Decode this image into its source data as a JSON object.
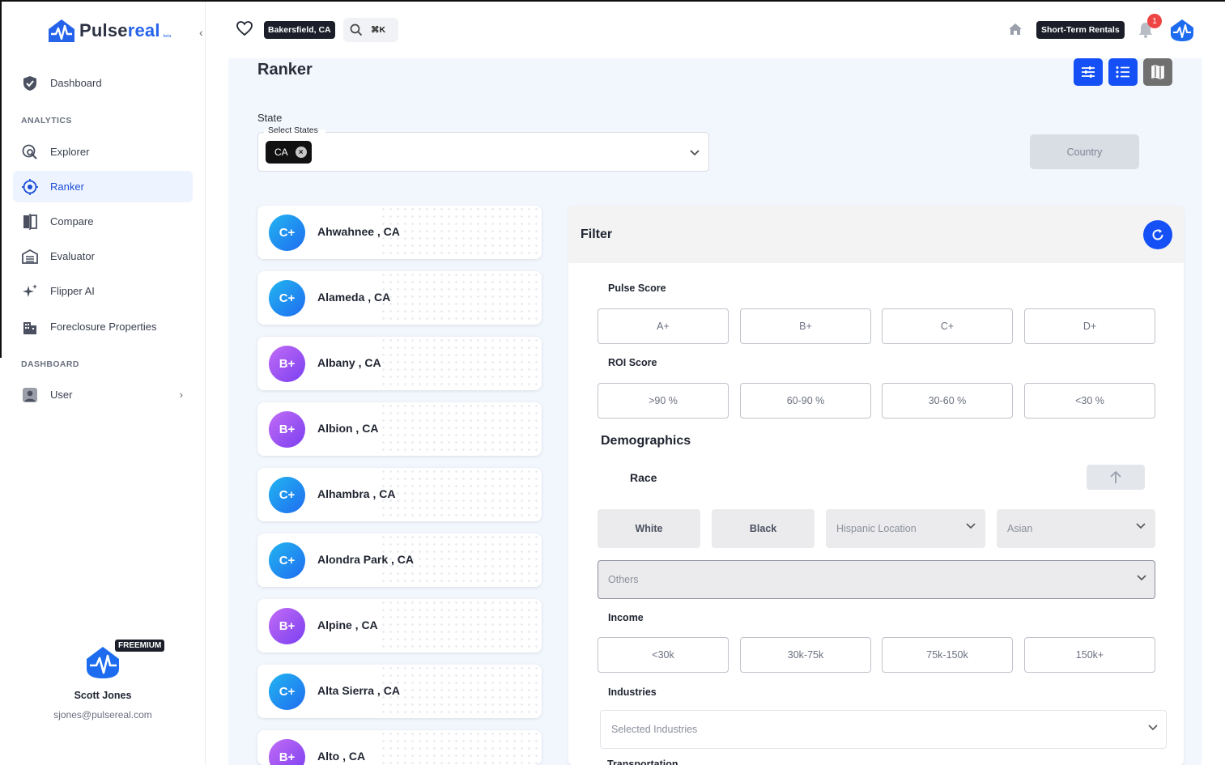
{
  "brand": {
    "name_part1": "Pulse",
    "name_part2": "real",
    "subtitle": "beta"
  },
  "sidebar": {
    "dashboard": "Dashboard",
    "analytics_section": "ANALYTICS",
    "items": [
      {
        "label": "Explorer"
      },
      {
        "label": "Ranker"
      },
      {
        "label": "Compare"
      },
      {
        "label": "Evaluator"
      },
      {
        "label": "Flipper AI"
      },
      {
        "label": "Foreclosure Properties"
      }
    ],
    "dashboard_section": "DASHBOARD",
    "user": "User"
  },
  "profile": {
    "badge": "FREEMIUM",
    "name": "Scott Jones",
    "email": "sjones@pulsereal.com"
  },
  "topbar": {
    "location": "Bakersfield, CA",
    "shortcut": "⌘K",
    "mode": "Short-Term Rentals",
    "notifications": "1"
  },
  "page": {
    "title": "Ranker",
    "state_label": "State",
    "select_label": "Select States",
    "selected_state": "CA",
    "country_button": "Country"
  },
  "cities": [
    {
      "grade": "C+",
      "name": "Ahwahnee , CA"
    },
    {
      "grade": "C+",
      "name": "Alameda , CA"
    },
    {
      "grade": "B+",
      "name": "Albany , CA"
    },
    {
      "grade": "B+",
      "name": "Albion , CA"
    },
    {
      "grade": "C+",
      "name": "Alhambra , CA"
    },
    {
      "grade": "C+",
      "name": "Alondra Park , CA"
    },
    {
      "grade": "B+",
      "name": "Alpine , CA"
    },
    {
      "grade": "C+",
      "name": "Alta Sierra , CA"
    },
    {
      "grade": "B+",
      "name": "Alto , CA"
    }
  ],
  "filter": {
    "title": "Filter",
    "pulse_score": {
      "label": "Pulse Score",
      "options": [
        "A+",
        "B+",
        "C+",
        "D+"
      ]
    },
    "roi_score": {
      "label": "ROI Score",
      "options": [
        ">90 %",
        "60-90 %",
        "30-60 %",
        "<30 %"
      ]
    },
    "demographics": "Demographics",
    "race": {
      "label": "Race",
      "white": "White",
      "black": "Black",
      "hispanic_placeholder": "Hispanic Location",
      "asian_placeholder": "Asian",
      "others_placeholder": "Others"
    },
    "income": {
      "label": "Income",
      "options": [
        "<30k",
        "30k-75k",
        "75k-150k",
        "150k+"
      ]
    },
    "industries": {
      "label": "Industries",
      "placeholder": "Selected Industries"
    },
    "transportation": "Transportation"
  },
  "colors": {
    "accent": "#1450f5",
    "grade_c": "#1f8cf0",
    "grade_b": "#9b52f2",
    "dark_badge": "#1c1f2a"
  }
}
